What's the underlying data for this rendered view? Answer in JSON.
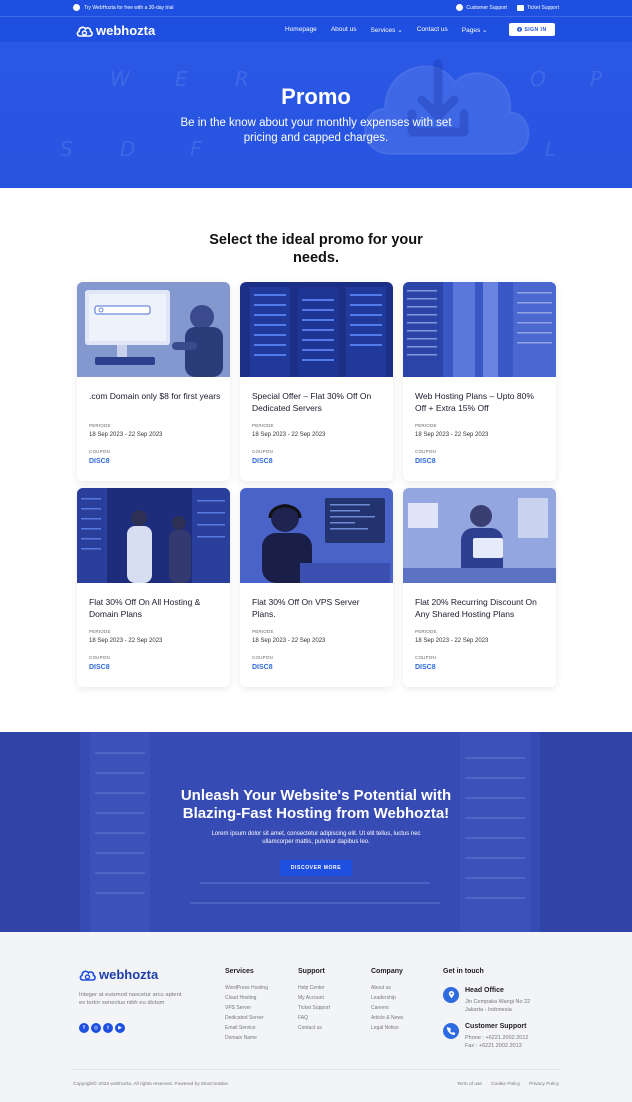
{
  "topbar": {
    "trial": "Try WebHozta for free with a 30-day trial",
    "support": "Customer Support",
    "ticket": "Ticket Support"
  },
  "nav": {
    "logo": "webhozta",
    "items": [
      "Homepage",
      "About us",
      "Services",
      "Contact us",
      "Pages"
    ],
    "signin": "SIGN IN"
  },
  "hero": {
    "title": "Promo",
    "subtitle": "Be in the know about your monthly expenses with set pricing and capped charges."
  },
  "section": {
    "title": "Select the ideal promo for your needs."
  },
  "promos": [
    {
      "title": ".com Domain only $8 for first years",
      "period_label": "PERIODE",
      "period": "18 Sep 2023 - 22 Sep 2023",
      "coupon_label": "COUPON",
      "coupon": "DISC8"
    },
    {
      "title": "Special Offer – Flat 30% Off On Dedicated Servers",
      "period_label": "PERIODE",
      "period": "18 Sep 2023 - 22 Sep 2023",
      "coupon_label": "COUPON",
      "coupon": "DISC8"
    },
    {
      "title": "Web Hosting Plans – Upto 80% Off + Extra 15% Off",
      "period_label": "PERIODE",
      "period": "18 Sep 2023 - 22 Sep 2023",
      "coupon_label": "COUPON",
      "coupon": "DISC8"
    },
    {
      "title": "Flat 30% Off On All Hosting & Domain Plans",
      "period_label": "PERIODE",
      "period": "18 Sep 2023 - 22 Sep 2023",
      "coupon_label": "COUPON",
      "coupon": "DISC8"
    },
    {
      "title": "Flat 30% Off On VPS Server Plans.",
      "period_label": "PERIODE",
      "period": "18 Sep 2023 - 22 Sep 2023",
      "coupon_label": "COUPON",
      "coupon": "DISC8"
    },
    {
      "title": "Flat 20% Recurring Discount On Any Shared Hosting Plans",
      "period_label": "PERIODE",
      "period": "18 Sep 2023 - 22 Sep 2023",
      "coupon_label": "COUPON",
      "coupon": "DISC8"
    }
  ],
  "cta": {
    "title": "Unleash Your Website's Potential with Blazing-Fast Hosting from Webhozta!",
    "text": "Lorem ipsum dolor sit amet, consectetur adipiscing elit. Ut elit tellus, luctus nec ullamcorper mattis, pulvinar dapibus leo.",
    "button": "DISCOVER MORE"
  },
  "footer": {
    "logo": "webhozta",
    "description": "Integer at euismod nascetur arcu aptent ex tortor senectus nibh eu dictum",
    "columns": [
      {
        "title": "Services",
        "links": [
          "WordPress Hosting",
          "Cloud Hosting",
          "VPS Server",
          "Dedicated Server",
          "Email Service",
          "Domain Name"
        ]
      },
      {
        "title": "Support",
        "links": [
          "Help Center",
          "My Account",
          "Ticket Support",
          "FAQ",
          "Contact us"
        ]
      },
      {
        "title": "Company",
        "links": [
          "About us",
          "Leadership",
          "Careers",
          "Article & News",
          "Legal Notice"
        ]
      }
    ],
    "contact": {
      "title": "Get in touch",
      "office_title": "Head Office",
      "office_line1": "Jln Cempaka Wangi No 22",
      "office_line2": "Jakarta - Indonesia",
      "support_title": "Customer Support",
      "support_phone": "Phone : +6221.2002.2012",
      "support_fax": "Fax : +6221.2002.2013"
    },
    "copyright": "Copyright© 2023 webhozta. All rights reserved. Powered by MoxCreative.",
    "legal": [
      "Term of use",
      "Cookie Policy",
      "Privacy Policy"
    ]
  },
  "colors": {
    "brand": "#1f4fe0",
    "coupon": "#2f6be0",
    "footer_bg": "#f3f4f7"
  }
}
